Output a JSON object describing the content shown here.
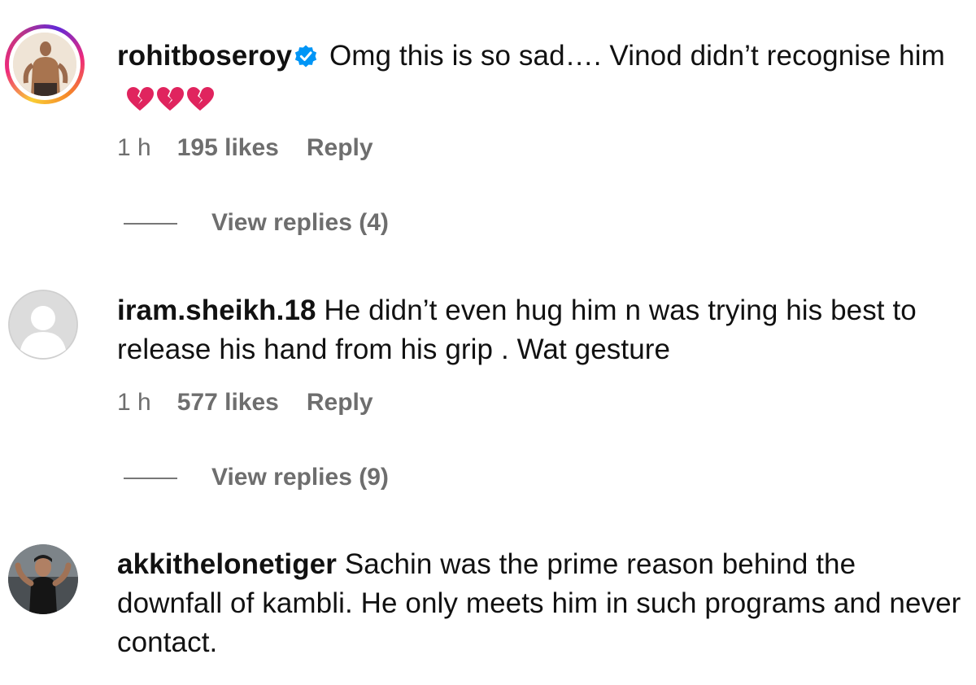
{
  "comments": [
    {
      "username": "rohitboseroy",
      "verified": true,
      "text": "Omg this is so sad…. Vinod didn’t recognise him",
      "emoji": "broken-heart x3",
      "time": "1 h",
      "likes": "195 likes",
      "reply": "Reply",
      "view_replies": "View replies (4)"
    },
    {
      "username": "iram.sheikh.18",
      "verified": false,
      "text": "He didn’t even hug him n was trying his best to release his hand from his grip . Wat gesture",
      "time": "1 h",
      "likes": "577 likes",
      "reply": "Reply",
      "view_replies": "View replies (9)"
    },
    {
      "username": "akkithelonetiger",
      "verified": false,
      "text": "Sachin was the prime reason behind the downfall of kambli. He only meets him in such programs and never contact."
    }
  ],
  "colors": {
    "verified_blue": "#0095f6",
    "meta_gray": "#6e6e6e",
    "heart_red": "#e0245e"
  }
}
